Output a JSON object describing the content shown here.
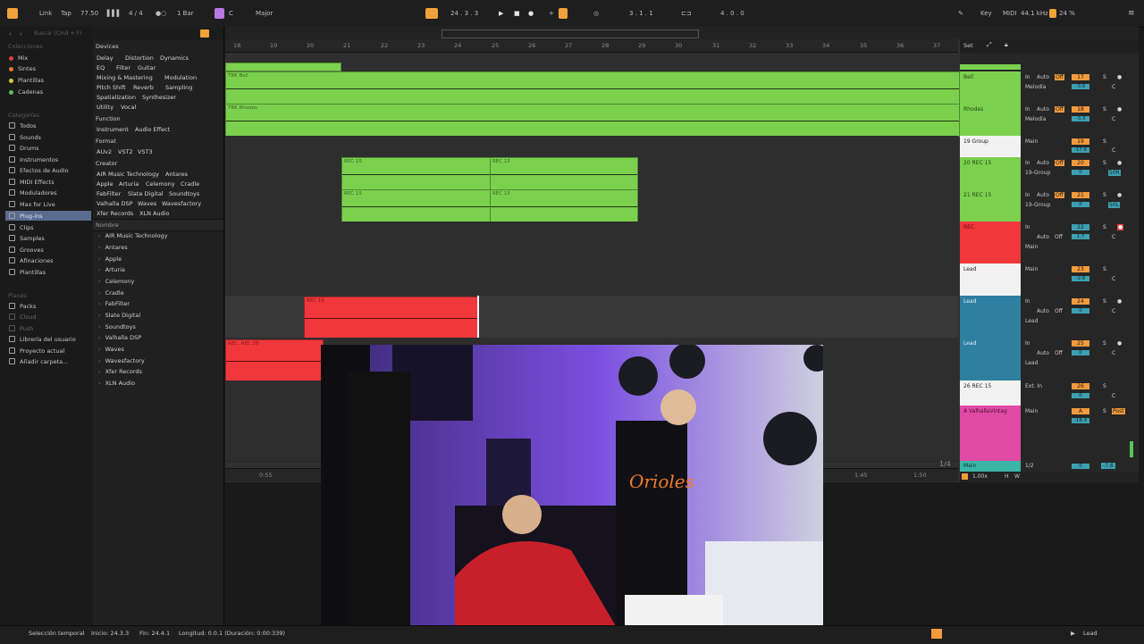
{
  "transport": {
    "link": "Link",
    "tap": "Tap",
    "tempo": "77.50",
    "signature": "4 / 4",
    "quant": "1 Bar",
    "key_root": "C",
    "scale": "Major",
    "position": "24 .  3 .  3",
    "loop_start": "3 .  1 .  1",
    "loop_len": "4 .  0 .  0",
    "key_label": "Key",
    "midi_label": "MIDI",
    "sample_rate": "44.1 kHz",
    "cpu": "24 %"
  },
  "browser": {
    "search_placeholder": "Buscar (Cmd + F)",
    "collections_header": "Colecciones",
    "collections": [
      {
        "label": "Mix",
        "color": "#e0413b"
      },
      {
        "label": "Sintes",
        "color": "#e87a2b"
      },
      {
        "label": "Plantillas",
        "color": "#d8c73a"
      },
      {
        "label": "Cadenas",
        "color": "#5cc35a"
      }
    ],
    "categories_header": "Categorías",
    "categories": [
      "Todos",
      "Sounds",
      "Drums",
      "Instrumentos",
      "Efectos de Audio",
      "MIDI Effects",
      "Moduladores",
      "Max for Live",
      "Plug-ins",
      "Clips",
      "Samples",
      "Grooves",
      "Afinaciones",
      "Plantillas"
    ],
    "selected_category": "Plug-ins",
    "places_header": "Places",
    "places": [
      "Packs",
      "Cloud",
      "Push",
      "Librería del usuario",
      "Proyecto actual",
      "Añadir carpeta..."
    ],
    "devices_header": "Devices",
    "device_tags": [
      [
        "Delay",
        "Distortion",
        "Dynamics"
      ],
      [
        "EQ",
        "Filter",
        "Guitar"
      ],
      [
        "Mixing & Mastering",
        "Modulation"
      ],
      [
        "Pitch Shift",
        "Reverb",
        "Sampling"
      ],
      [
        "Spatialization",
        "Synthesizer"
      ],
      [
        "Utility",
        "Vocal"
      ]
    ],
    "function_header": "Function",
    "function_tags": [
      "Instrument",
      "Audio Effect"
    ],
    "format_header": "Format",
    "format_tags": [
      "AUv2",
      "VST2",
      "VST3"
    ],
    "creator_header": "Creator",
    "creator_tags": [
      [
        "AIR Music Technology",
        "Antares"
      ],
      [
        "Apple",
        "Arturia",
        "Celemony",
        "Cradle"
      ],
      [
        "FabFilter",
        "Slate Digital",
        "Soundtoys"
      ],
      [
        "Valhalla DSP",
        "Waves",
        "Wavesfactory"
      ],
      [
        "Xfer Records",
        "XLN Audio"
      ]
    ],
    "name_col": "Nombre",
    "vendors": [
      "AIR Music Technology",
      "Antares",
      "Apple",
      "Arturia",
      "Celemony",
      "Cradle",
      "FabFilter",
      "Slate Digital",
      "Soundtoys",
      "Valhalla DSP",
      "Waves",
      "Wavesfactory",
      "Xfer Records",
      "XLN Audio"
    ]
  },
  "ruler": [
    "18",
    "19",
    "20",
    "21",
    "22",
    "23",
    "24",
    "25",
    "26",
    "27",
    "28",
    "29",
    "30",
    "31",
    "32",
    "33",
    "34",
    "35",
    "36",
    "37"
  ],
  "time_marks": [
    "0:55",
    "1:45",
    "1:50"
  ],
  "page_indicator": "1/4",
  "clips": {
    "bell": "TBK Bell",
    "rhodes": "TBK Rhodes",
    "rec": "REC 15",
    "rec25": "REC, REC 25"
  },
  "set_label": "Set",
  "tracks": [
    {
      "name": "Bell",
      "color": "#7bd14e",
      "in": "In",
      "auto": "Auto",
      "off": "Off",
      "route": "Melodía",
      "num": "17",
      "vol": "-3.6",
      "s": "S",
      "c": "C"
    },
    {
      "name": "Rhodes",
      "color": "#7bd14e",
      "in": "In",
      "auto": "Auto",
      "off": "Off",
      "route": "Melodía",
      "num": "18",
      "vol": "-3.3",
      "s": "S",
      "c": "C"
    },
    {
      "name": "19 Group",
      "color": "#ffffff",
      "in": "",
      "auto": "",
      "off": "",
      "route": "Main",
      "num": "19",
      "vol": "-17.6",
      "s": "S",
      "c": "C"
    },
    {
      "name": "20 REC 15",
      "color": "#7bd14e",
      "in": "In",
      "auto": "Auto",
      "off": "Off",
      "route": "19-Group",
      "num": "20",
      "vol": "0",
      "s": "S",
      "c": "50R"
    },
    {
      "name": "21 REC 15",
      "color": "#7bd14e",
      "in": "In",
      "auto": "Auto",
      "off": "Off",
      "route": "19-Group",
      "num": "21",
      "vol": "0",
      "s": "S",
      "c": "50L"
    },
    {
      "name": "REC",
      "color": "#f0383c",
      "in": "In",
      "auto": "Auto",
      "off": "Off",
      "route": "Main",
      "num": "22",
      "vol": "1.7",
      "s": "S",
      "c": "C"
    },
    {
      "name": "Lead",
      "color": "#ffffff",
      "in": "",
      "auto": "",
      "off": "",
      "route": "Main",
      "num": "23",
      "vol": "-2.6",
      "s": "S",
      "c": "C"
    },
    {
      "name": "Lead",
      "color": "#2e7fa0",
      "in": "In",
      "auto": "Auto",
      "off": "Off",
      "route": "Lead",
      "num": "24",
      "vol": "0",
      "s": "S",
      "c": "C"
    },
    {
      "name": "Lead",
      "color": "#2e7fa0",
      "in": "In",
      "auto": "Auto",
      "off": "Off",
      "route": "Lead",
      "num": "25",
      "vol": "0",
      "s": "S",
      "c": "C"
    },
    {
      "name": "26 REC 15",
      "color": "#ffffff",
      "in": "",
      "auto": "",
      "off": "",
      "route": "Ext. In",
      "num": "26",
      "vol": "0",
      "s": "S",
      "c": "C"
    },
    {
      "name": "A ValhallaVintag",
      "color": "#e04aa4",
      "in": "",
      "auto": "",
      "off": "",
      "route": "Main",
      "num": "A",
      "vol": "-18.4",
      "s": "S",
      "c": "Post"
    }
  ],
  "main_track": {
    "name": "Main",
    "route": "1/2",
    "vol": "0",
    "pan": "-7.8"
  },
  "tempo_nudge": "1.00x",
  "status": {
    "selection": "Selección temporal",
    "start": "Inicio: 24.3.3",
    "end": "Fin: 24.4.1",
    "length": "Longitud: 0.0.1 (Duración: 0:00:339)",
    "track": "Lead"
  }
}
